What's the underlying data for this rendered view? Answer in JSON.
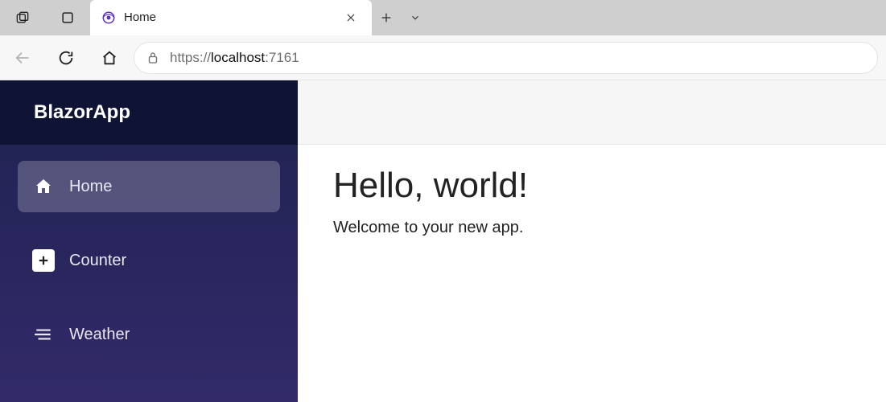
{
  "browser": {
    "tab_title": "Home",
    "url_scheme": "https://",
    "url_host": "localhost",
    "url_port": ":7161"
  },
  "sidebar": {
    "brand": "BlazorApp",
    "items": [
      {
        "label": "Home"
      },
      {
        "label": "Counter"
      },
      {
        "label": "Weather"
      }
    ]
  },
  "page": {
    "heading": "Hello, world!",
    "subtext": "Welcome to your new app."
  }
}
